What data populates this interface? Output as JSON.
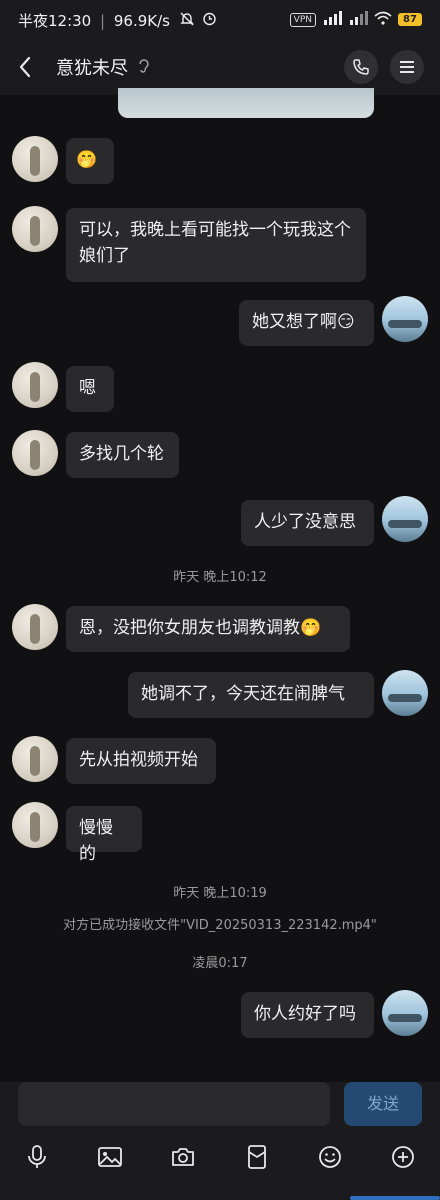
{
  "status": {
    "time": "半夜12:30",
    "speed": "96.9K/s",
    "vpn": "VPN",
    "battery": "87"
  },
  "header": {
    "title": "意犹未尽"
  },
  "messages": [
    {
      "text": "🤭"
    },
    {
      "text": "可以，我晚上看可能找一个玩我这个娘们了"
    },
    {
      "text": "她又想了啊😏"
    },
    {
      "text": "嗯"
    },
    {
      "text": "多找几个轮"
    },
    {
      "text": "人少了没意思"
    },
    {
      "text": "恩，没把你女朋友也调教调教🤭"
    },
    {
      "text": "她调不了，今天还在闹脾气"
    },
    {
      "text": "先从拍视频开始"
    },
    {
      "text": "慢慢的"
    },
    {
      "text": "你人约好了吗"
    }
  ],
  "timestamps": {
    "t1": "昨天 晚上10:12",
    "t2": "昨天 晚上10:19",
    "t3": "凌晨0:17"
  },
  "system": {
    "file_notice": "对方已成功接收文件\"VID_20250313_223142.mp4\""
  },
  "input": {
    "send_label": "发送"
  },
  "icons": [
    "mic-icon",
    "image-icon",
    "camera-icon",
    "red-packet-icon",
    "emoji-icon",
    "plus-icon"
  ]
}
